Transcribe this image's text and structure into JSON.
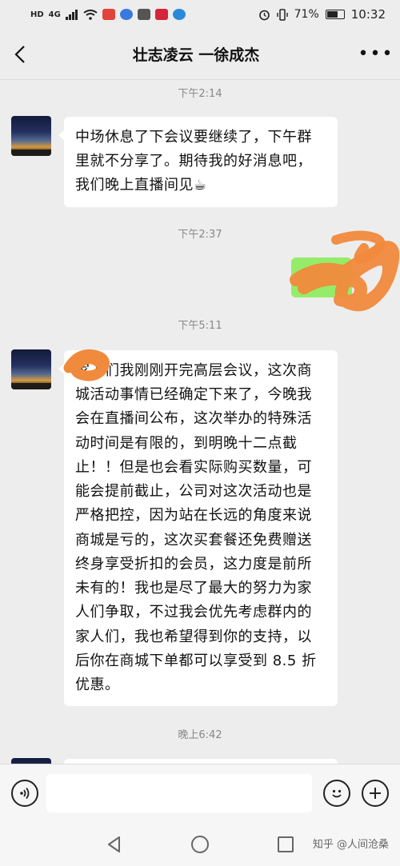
{
  "status_bar": {
    "left_tags": [
      "HD",
      "4G"
    ],
    "battery": "71%",
    "battery_level": 0.71,
    "time": "10:32"
  },
  "header": {
    "title": "壮志凌云 一徐成杰",
    "back_icon": "chevron-left-icon",
    "more_icon": "more-dots-icon",
    "more_label": "•••"
  },
  "messages": [
    {
      "type": "timestamp",
      "text": "下午2:14"
    },
    {
      "type": "incoming",
      "text": "中场休息了下会议要继续了，下午群里就不分享了。期待我的好消息吧，我们晚上直播间见☕"
    },
    {
      "type": "timestamp",
      "text": "下午2:37"
    },
    {
      "type": "outgoing",
      "text": ""
    },
    {
      "type": "timestamp",
      "text": "下午5:11"
    },
    {
      "type": "incoming",
      "text": "家人们我刚刚开完高层会议，这次商城活动事情已经确定下来了，今晚我会在直播间公布，这次举办的特殊活动时间是有限的，到明晚十二点截止！！但是也会看实际购买数量，可能会提前截止，公司对这次活动也是严格把控，因为站在长远的角度来说商城是亏的，这次买套餐还免费赠送终身享受折扣的会员，这力度是前所未有的！我也是尽了最大的努力为家人们争取，不过我会优先考虑群内的家人们，我也希望得到你的支持，以后你在商城下单都可以享受到 8.5 折优惠。"
    },
    {
      "type": "timestamp",
      "text": "晚上6:42"
    }
  ],
  "input_bar": {
    "voice_icon": "voice-icon",
    "emoji_icon": "emoji-icon",
    "plus_icon": "plus-icon",
    "placeholder": ""
  },
  "nav_bar": {
    "back_icon": "nav-back-icon",
    "home_icon": "nav-home-icon",
    "recents_icon": "nav-recents-icon"
  },
  "watermark": "知乎 @人间沧桑",
  "colors": {
    "background": "#ededed",
    "incoming_bubble": "#ffffff",
    "outgoing_bubble": "#95ec69",
    "scribble": "#f08a3c"
  }
}
